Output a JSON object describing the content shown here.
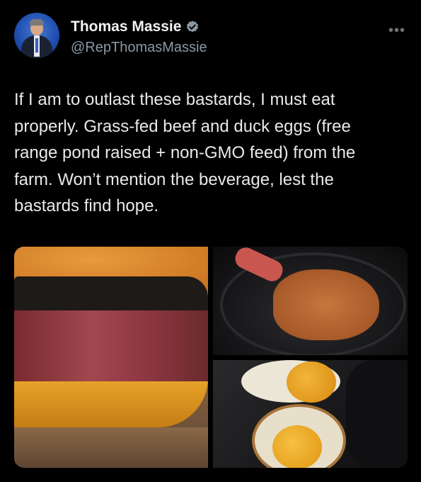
{
  "author": {
    "name": "Thomas Massie",
    "handle": "@RepThomasMassie",
    "verified": true,
    "verified_icon": "verified-badge-icon"
  },
  "more_icon": "more-options-icon",
  "tweet": {
    "text": "If I am to outlast these bastards, I must eat properly. Grass-fed beef and duck eggs (free range pond raised + non-GMO feed) from the farm. Won’t mention the beverage, lest the bastards find hope."
  },
  "media": [
    {
      "name": "steak-cross-section-image"
    },
    {
      "name": "steak-in-pan-image"
    },
    {
      "name": "fried-duck-eggs-image"
    }
  ],
  "colors": {
    "background": "#000000",
    "text": "#e7e9ea",
    "secondary_text": "#8b98a5",
    "verified_badge": "#8b98a5"
  }
}
